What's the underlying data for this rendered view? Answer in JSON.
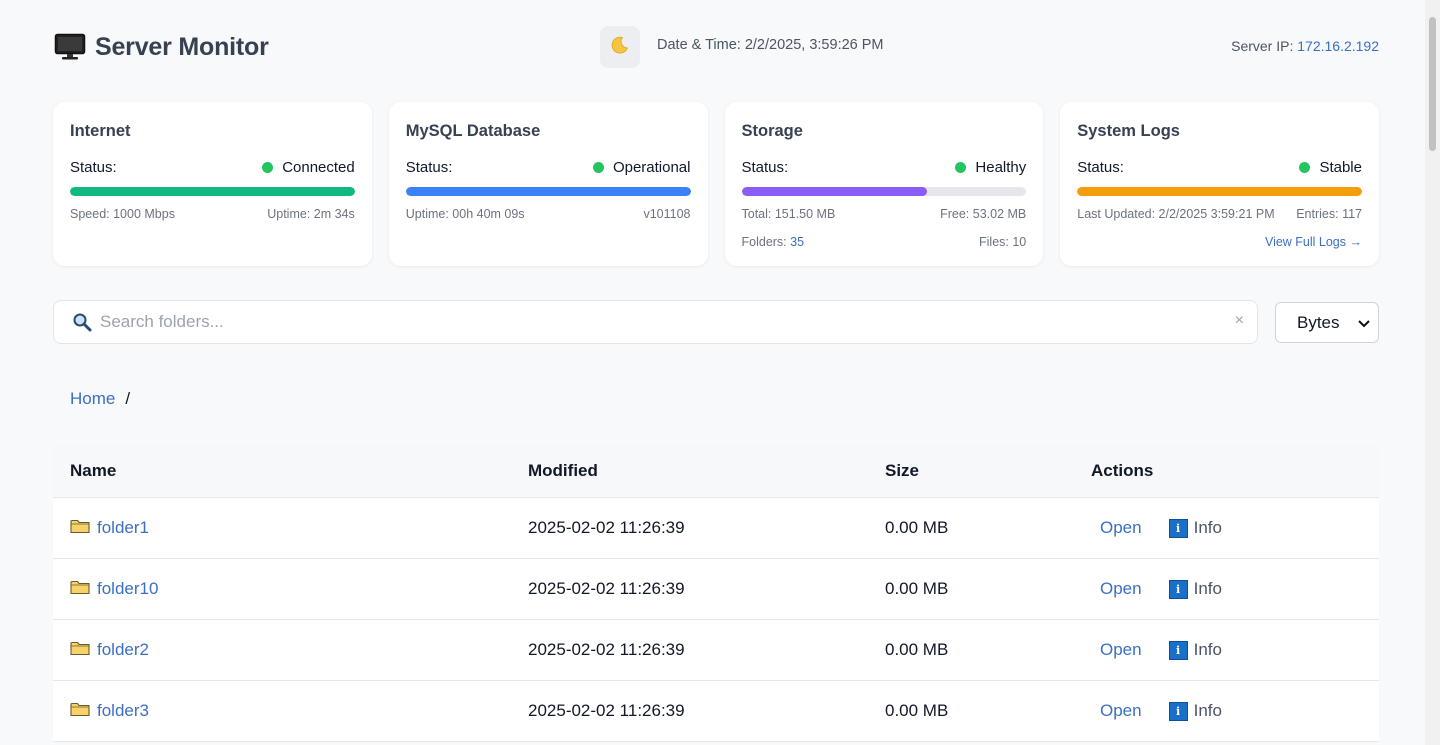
{
  "header": {
    "title": "Server Monitor",
    "brand_icon": "monitor-icon",
    "theme_icon": "moon-icon",
    "datetime_label": "Date & Time:",
    "datetime_value": "2/2/2025, 3:59:26 PM",
    "server_ip_label": "Server IP:",
    "server_ip_value": "172.16.2.192"
  },
  "cards": {
    "internet": {
      "title": "Internet",
      "status_label": "Status:",
      "status_value": "Connected",
      "progress": 1.0,
      "bar_color": "#10b981",
      "speed": "Speed: 1000 Mbps",
      "uptime": "Uptime: 2m 34s"
    },
    "mysql": {
      "title": "MySQL Database",
      "status_label": "Status:",
      "status_value": "Operational",
      "progress": 1.0,
      "bar_color": "#3b82f6",
      "uptime": "Uptime: 00h 40m 09s",
      "version": "v101108"
    },
    "storage": {
      "title": "Storage",
      "status_label": "Status:",
      "status_value": "Healthy",
      "progress": 0.65,
      "bar_color": "#8b5cf6",
      "total": "Total: 151.50 MB",
      "free": "Free: 53.02 MB",
      "folders_label": "Folders:",
      "folders_value": "35",
      "files": "Files: 10"
    },
    "logs": {
      "title": "System Logs",
      "status_label": "Status:",
      "status_value": "Stable",
      "progress": 1.0,
      "bar_color": "#f59e0b",
      "last_updated": "Last Updated: 2/2/2025 3:59:21 PM",
      "entries": "Entries: 117",
      "view_link": "View Full Logs →"
    }
  },
  "status_dot_color": "#22c55e",
  "search": {
    "placeholder": "Search folders...",
    "clear": "×",
    "icon": "search-icon"
  },
  "unit_select": {
    "selected": "Bytes"
  },
  "breadcrumb": {
    "home": "Home",
    "sep": "/"
  },
  "table": {
    "headers": {
      "name": "Name",
      "modified": "Modified",
      "size": "Size",
      "actions": "Actions"
    },
    "rows": [
      {
        "name": "folder1",
        "modified": "2025-02-02 11:26:39",
        "size": "0.00 MB",
        "open": "Open",
        "info": "Info"
      },
      {
        "name": "folder10",
        "modified": "2025-02-02 11:26:39",
        "size": "0.00 MB",
        "open": "Open",
        "info": "Info"
      },
      {
        "name": "folder2",
        "modified": "2025-02-02 11:26:39",
        "size": "0.00 MB",
        "open": "Open",
        "info": "Info"
      },
      {
        "name": "folder3",
        "modified": "2025-02-02 11:26:39",
        "size": "0.00 MB",
        "open": "Open",
        "info": "Info"
      }
    ]
  }
}
